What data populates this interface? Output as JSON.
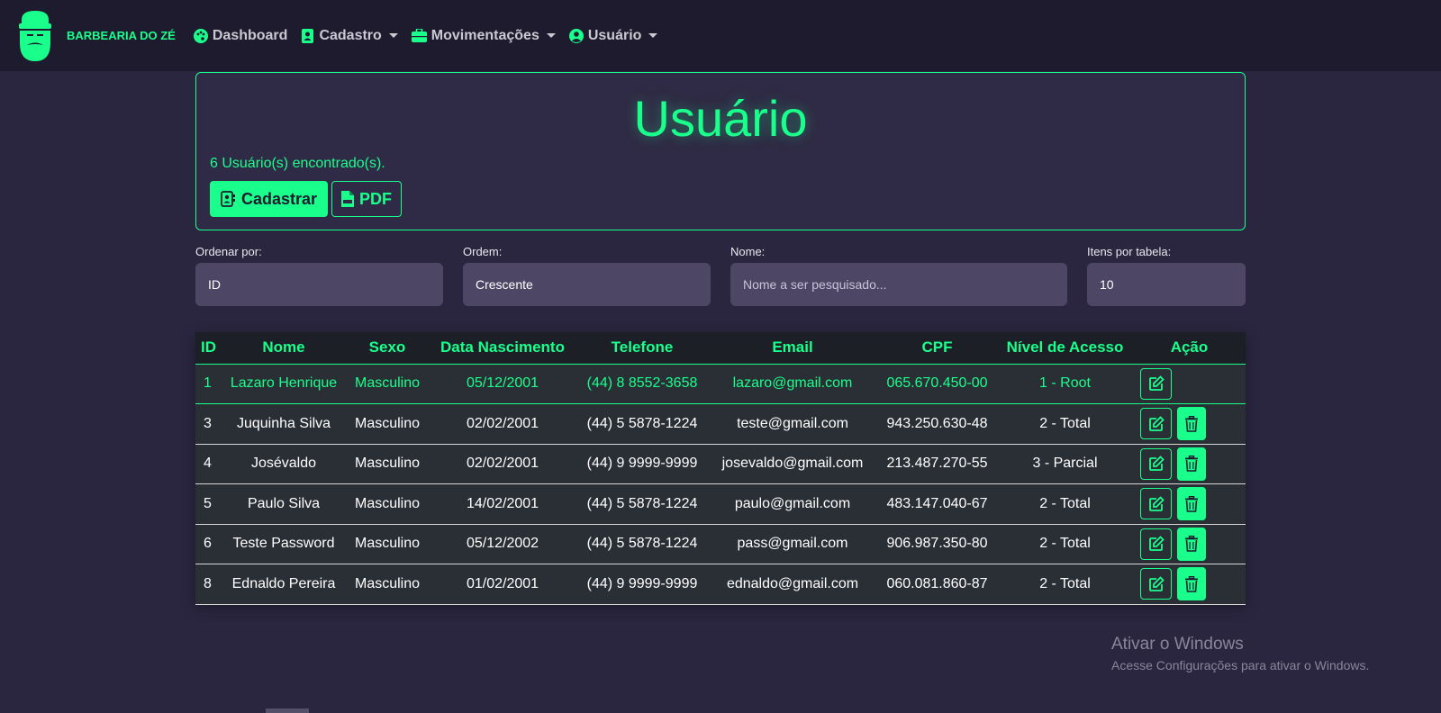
{
  "navbar": {
    "brand": "BARBEARIA DO ZÉ",
    "items": [
      {
        "label": "Dashboard",
        "icon": "palette-icon",
        "dropdown": false
      },
      {
        "label": "Cadastro",
        "icon": "address-book-icon",
        "dropdown": true
      },
      {
        "label": "Movimentações",
        "icon": "briefcase-icon",
        "dropdown": true
      },
      {
        "label": "Usuário",
        "icon": "user-circle-icon",
        "dropdown": true
      }
    ]
  },
  "header": {
    "title": "Usuário",
    "count_text": "6 Usuário(s) encontrado(s).",
    "cadastrar_label": "Cadastrar",
    "pdf_label": "PDF"
  },
  "filters": {
    "ordenar_label": "Ordenar por:",
    "ordenar_value": "ID",
    "ordem_label": "Ordem:",
    "ordem_value": "Crescente",
    "nome_label": "Nome:",
    "nome_placeholder": "Nome a ser pesquisado...",
    "itens_label": "Itens por tabela:",
    "itens_value": "10"
  },
  "table": {
    "headers": [
      "ID",
      "Nome",
      "Sexo",
      "Data Nascimento",
      "Telefone",
      "Email",
      "CPF",
      "Nível de Acesso",
      "Ação"
    ],
    "rows": [
      {
        "id": "1",
        "nome": "Lazaro Henrique",
        "sexo": "Masculino",
        "nascimento": "05/12/2001",
        "telefone": "(44) 8 8552-3658",
        "email": "lazaro@gmail.com",
        "cpf": "065.670.450-00",
        "nivel": "1 - Root"
      },
      {
        "id": "3",
        "nome": "Juquinha Silva",
        "sexo": "Masculino",
        "nascimento": "02/02/2001",
        "telefone": "(44) 5 5878-1224",
        "email": "teste@gmail.com",
        "cpf": "943.250.630-48",
        "nivel": "2 - Total"
      },
      {
        "id": "4",
        "nome": "Josévaldo",
        "sexo": "Masculino",
        "nascimento": "02/02/2001",
        "telefone": "(44) 9 9999-9999",
        "email": "josevaldo@gmail.com",
        "cpf": "213.487.270-55",
        "nivel": "3 - Parcial"
      },
      {
        "id": "5",
        "nome": "Paulo Silva",
        "sexo": "Masculino",
        "nascimento": "14/02/2001",
        "telefone": "(44) 5 5878-1224",
        "email": "paulo@gmail.com",
        "cpf": "483.147.040-67",
        "nivel": "2 - Total"
      },
      {
        "id": "6",
        "nome": "Teste Password",
        "sexo": "Masculino",
        "nascimento": "05/12/2002",
        "telefone": "(44) 5 5878-1224",
        "email": "pass@gmail.com",
        "cpf": "906.987.350-80",
        "nivel": "2 - Total"
      },
      {
        "id": "8",
        "nome": "Ednaldo Pereira",
        "sexo": "Masculino",
        "nascimento": "01/02/2001",
        "telefone": "(44) 9 9999-9999",
        "email": "ednaldo@gmail.com",
        "cpf": "060.081.860-87",
        "nivel": "2 - Total"
      }
    ]
  },
  "watermark": {
    "title": "Ativar o Windows",
    "subtitle": "Acesse Configurações para ativar o Windows."
  },
  "colors": {
    "accent": "#1aff8c",
    "background": "#2a2640",
    "navbar": "#1e1b2e"
  }
}
